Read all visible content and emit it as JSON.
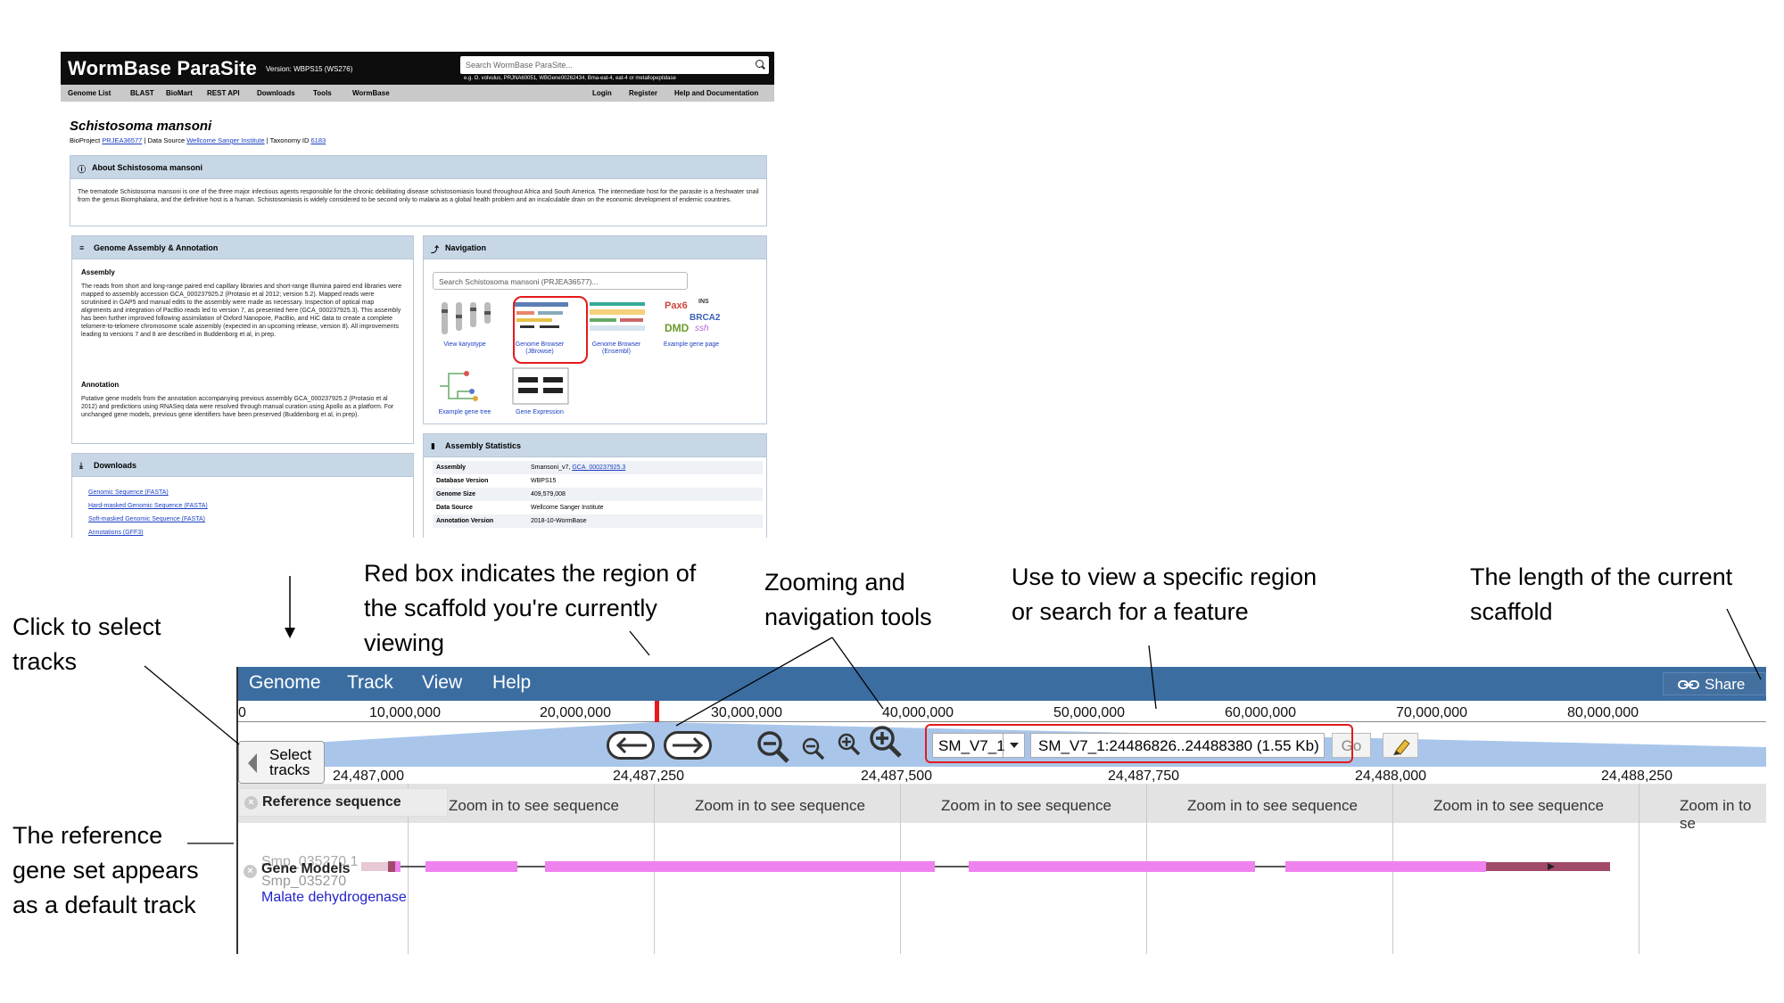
{
  "wormbase": {
    "logo": "WormBase ParaSite",
    "version": "Version: WBPS15 (WS276)",
    "search_placeholder": "Search WormBase ParaSite...",
    "search_hint": "e.g. O. volvulus, PRJNA60051, WBGene00262434, Bma-eat-4, eat-4 or metallopeptidase",
    "nav_left": [
      "Genome List",
      "BLAST",
      "BioMart",
      "REST API",
      "Downloads",
      "Tools",
      "WormBase"
    ],
    "nav_right": [
      "Login",
      "Register",
      "Help and Documentation"
    ],
    "species": "Schistosoma mansoni",
    "bioproject_label": "BioProject",
    "bioproject": "PRJEA36577",
    "data_source_label": "| Data Source",
    "data_source": "Wellcome Sanger Institute",
    "taxonomy_label": "| Taxonomy ID",
    "taxonomy": "6183",
    "about_title": "About Schistosoma mansoni",
    "about_text": "The trematode Schistosoma mansoni is one of the three major infectious agents responsible for the chronic debilitating disease schistosomiasis found throughout Africa and South America. The intermediate host for the parasite is a freshwater snail from the genus Biomphalaria, and the definitive host is a human. Schistosomiasis is widely considered to be second only to malaria as a global health problem and an incalculable drain on the economic development of endemic countries.",
    "assembly_panel_title": "Genome Assembly & Annotation",
    "assembly_heading": "Assembly",
    "assembly_text": "The reads from short and long-range paired end capillary libraries and short-range Illumina paired end libraries were mapped to assembly accession GCA_000237925.2 (Protasio et al 2012; version 5.2). Mapped reads were scrutinised in GAP5 and manual edits to the assembly were made as necessary. Inspection of optical map alignments and integration of PacBio reads led to version 7, as presented here (GCA_000237925.3). This assembly has been further improved following assimilation of Oxford Nanopore, PacBio, and HiC data to create a complete telomere-to-telomere chromosome scale assembly (expected in an upcoming release, version 8). All improvements leading to versions 7 and 8 are described in Buddenborg et al, in prep.",
    "annotation_heading": "Annotation",
    "annotation_text": "Putative gene models from the annotation accompanying previous assembly GCA_000237925.2 (Protasio et al 2012) and predictions using RNASeq data were resolved through manual curation using Apollo as a platform. For unchanged gene models, previous gene identifiers have been preserved (Buddenborg et al, in prep).",
    "downloads_title": "Downloads",
    "downloads": [
      "Genomic Sequence (FASTA)",
      "Hard-masked Genomic Sequence (FASTA)",
      "Soft-masked Genomic Sequence (FASTA)",
      "Annotations (GFF3)"
    ],
    "navigation_title": "Navigation",
    "navigation_search": "Search Schistosoma mansoni (PRJEA36577)...",
    "nav_items": [
      "View karyotype",
      "Genome Browser (JBrowse)",
      "Genome Browser (Ensembl)",
      "Example gene page",
      "Example gene tree",
      "Gene Expression"
    ],
    "stats_title": "Assembly Statistics",
    "stats": [
      {
        "k": "Assembly",
        "v": "Smansoni_v7,"
      },
      {
        "k": "Database Version",
        "v": "WBPS15"
      },
      {
        "k": "Genome Size",
        "v": "409,579,008"
      },
      {
        "k": "Data Source",
        "v": "Wellcome Sanger Institute"
      },
      {
        "k": "Annotation Version",
        "v": "2018-10-WormBase"
      }
    ],
    "stats_assembly_link": "GCA_000237925.3",
    "example_gene_labels": [
      "Pax6",
      "INS",
      "BRCA2",
      "DMD",
      "ssh"
    ]
  },
  "annotations": {
    "select_tracks": "Click to select\ntracks",
    "red_box": "Red box indicates the region of\nthe scaffold you're currently\nviewing",
    "zooming": "Zooming and\nnavigation tools",
    "view_region": "Use to view a specific region\nor search for a feature",
    "length": "The length of the current\nscaffold",
    "reference_gene": "The reference\ngene set appears\nas a default track"
  },
  "jbrowse": {
    "menus": [
      "Genome",
      "Track",
      "View",
      "Help"
    ],
    "share": "Share",
    "overview_ticks": [
      "0",
      "10,000,000",
      "20,000,000",
      "30,000,000",
      "40,000,000",
      "50,000,000",
      "60,000,000",
      "70,000,000",
      "80,000,000"
    ],
    "select_tracks": "Select\ntracks",
    "ref_seq": "SM_V7_1",
    "location": "SM_V7_1:24486826..24488380 (1.55 Kb)",
    "go": "Go",
    "scale_ticks": [
      "24,487,000",
      "24,487,250",
      "24,487,500",
      "24,487,750",
      "24,488,000",
      "24,488,250"
    ],
    "track_reference": "Reference sequence",
    "zoom_message": "Zoom in to see sequence",
    "zoom_message_cut": "Zoom in to se",
    "track_gene_models": "Gene Models",
    "gene_id_1": "Smp_035270.1",
    "gene_id_2": "Smp_035270",
    "gene_desc": "Malate dehydrogenase"
  },
  "colors": {
    "menubar": "#3b6da1",
    "exon": "#ee82ee",
    "utr": "#a24a6a",
    "highlight": "#e41a1c"
  }
}
